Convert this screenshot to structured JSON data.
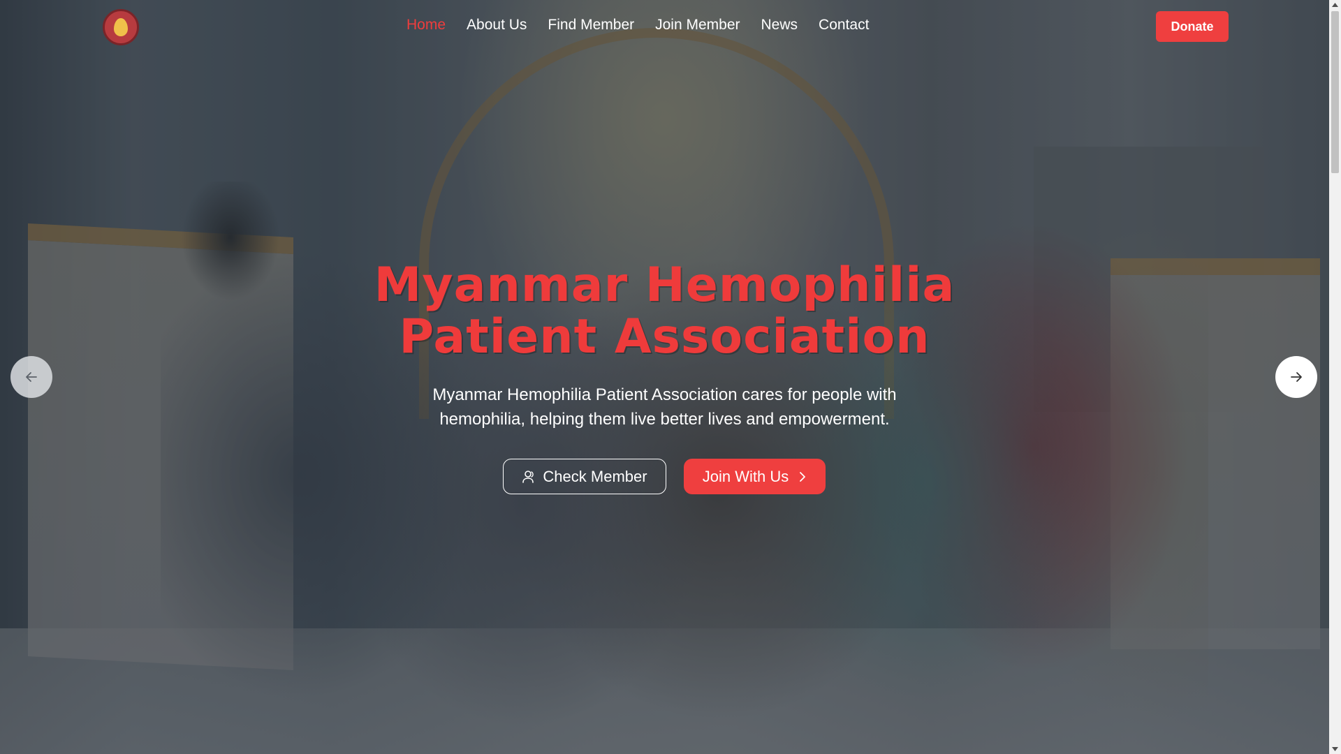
{
  "nav": {
    "items": [
      {
        "label": "Home",
        "active": true
      },
      {
        "label": "About Us",
        "active": false
      },
      {
        "label": "Find Member",
        "active": false
      },
      {
        "label": "Join Member",
        "active": false
      },
      {
        "label": "News",
        "active": false
      },
      {
        "label": "Contact",
        "active": false
      }
    ],
    "donate_label": "Donate"
  },
  "hero": {
    "title": "Myanmar Hemophilia Patient Association",
    "subtitle": "Myanmar Hemophilia Patient Association cares for people with hemophilia, helping them live better lives and empowerment.",
    "check_member_label": "Check Member",
    "join_label": "Join With Us"
  },
  "icons": {
    "logo": "association-logo",
    "check_member": "user-icon",
    "join": "chevron-right-icon",
    "prev": "arrow-left-icon",
    "next": "arrow-right-icon"
  },
  "colors": {
    "accent": "#ef3f3f",
    "text": "#ffffff"
  }
}
